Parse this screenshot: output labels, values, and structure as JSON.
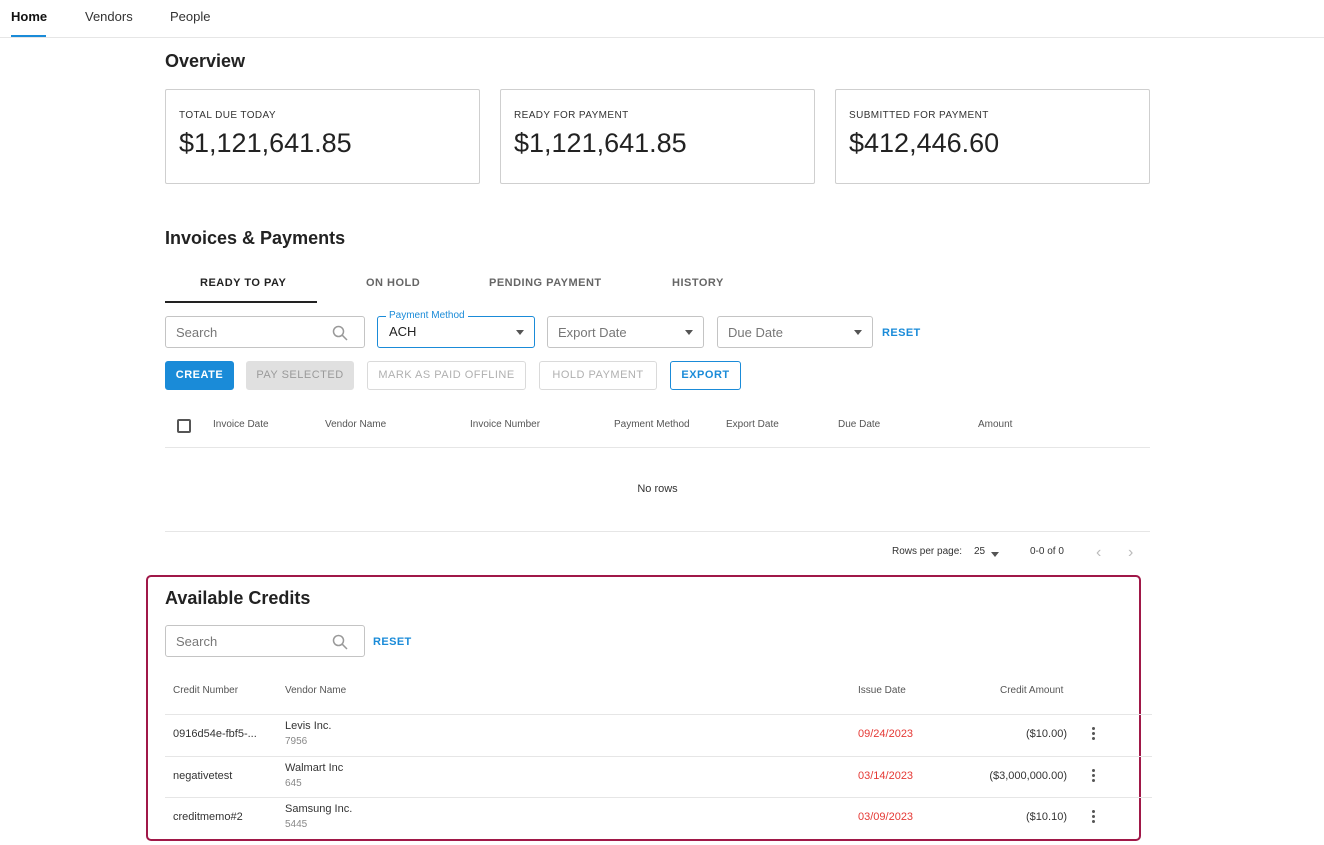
{
  "nav": {
    "tabs": [
      "Home",
      "Vendors",
      "People"
    ],
    "active": "Home"
  },
  "overview": {
    "title": "Overview",
    "cards": [
      {
        "label": "TOTAL DUE TODAY",
        "value": "$1,121,641.85"
      },
      {
        "label": "READY FOR PAYMENT",
        "value": "$1,121,641.85"
      },
      {
        "label": "SUBMITTED FOR PAYMENT",
        "value": "$412,446.60"
      }
    ]
  },
  "invoices": {
    "title": "Invoices & Payments",
    "tabs": [
      "READY TO PAY",
      "ON HOLD",
      "PENDING PAYMENT",
      "HISTORY"
    ],
    "active_tab": "READY TO PAY",
    "filters": {
      "search_placeholder": "Search",
      "payment_method_label": "Payment Method",
      "payment_method_value": "ACH",
      "export_date_placeholder": "Export Date",
      "due_date_placeholder": "Due Date",
      "reset": "RESET"
    },
    "buttons": {
      "create": "CREATE",
      "pay_selected": "PAY SELECTED",
      "mark_paid": "MARK AS PAID OFFLINE",
      "hold": "HOLD PAYMENT",
      "export": "EXPORT"
    },
    "columns": [
      "Invoice Date",
      "Vendor Name",
      "Invoice Number",
      "Payment Method",
      "Export Date",
      "Due Date",
      "Amount"
    ],
    "empty_text": "No rows",
    "pager": {
      "rows_label": "Rows per page:",
      "rows_value": "25",
      "range": "0-0 of 0"
    }
  },
  "credits": {
    "title": "Available Credits",
    "search_placeholder": "Search",
    "reset": "RESET",
    "columns": [
      "Credit Number",
      "Vendor Name",
      "Issue Date",
      "Credit Amount"
    ],
    "rows": [
      {
        "number": "0916d54e-fbf5-...",
        "vendor": "Levis Inc.",
        "vendor_id": "7956",
        "date": "09/24/2023",
        "amount": "($10.00)"
      },
      {
        "number": "negativetest",
        "vendor": "Walmart Inc",
        "vendor_id": "645",
        "date": "03/14/2023",
        "amount": "($3,000,000.00)"
      },
      {
        "number": "creditmemo#2",
        "vendor": "Samsung Inc.",
        "vendor_id": "5445",
        "date": "03/09/2023",
        "amount": "($10.10)"
      }
    ]
  },
  "colors": {
    "accent": "#1a8bd8",
    "date_red": "#e53935",
    "highlight": "#a01848"
  }
}
